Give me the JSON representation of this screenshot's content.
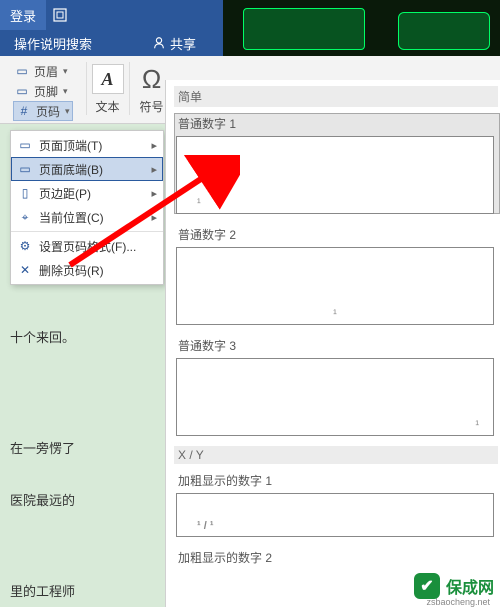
{
  "titlebar": {
    "login": "登录",
    "min": "—",
    "max": "◻",
    "restore": "⧉",
    "close": "✕"
  },
  "topbar": {
    "help_search": "操作说明搜索",
    "share": "共享",
    "share_icon": "👤"
  },
  "ribbon": {
    "header": "页眉",
    "footer": "页脚",
    "page_number": "页码",
    "textbox_group": "文本",
    "symbol_group": "符号"
  },
  "dropdown": {
    "items": [
      {
        "label": "页面顶端(T)",
        "sub": true,
        "sel": false
      },
      {
        "label": "页面底端(B)",
        "sub": true,
        "sel": true
      },
      {
        "label": "页边距(P)",
        "sub": true,
        "sel": false
      },
      {
        "label": "当前位置(C)",
        "sub": true,
        "sel": false
      },
      {
        "label": "设置页码格式(F)...",
        "sub": false,
        "sel": false
      },
      {
        "label": "删除页码(R)",
        "sub": false,
        "sel": false
      }
    ]
  },
  "gallery": {
    "section_simple": "简单",
    "items": [
      {
        "label": "普通数字 1",
        "sel": true
      },
      {
        "label": "普通数字 2",
        "sel": false
      },
      {
        "label": "普通数字 3",
        "sel": false
      }
    ],
    "section_xy": "X / Y",
    "xy_items": [
      {
        "label": "加粗显示的数字 1"
      },
      {
        "label": "加粗显示的数字 2"
      }
    ]
  },
  "doc": {
    "p1": "十个来回。",
    "p2": "在一旁愣了",
    "p3": "医院最远的",
    "p4": "里的工程师"
  },
  "watermark": {
    "name": "保成网",
    "sub": "zsbaocheng.net"
  }
}
